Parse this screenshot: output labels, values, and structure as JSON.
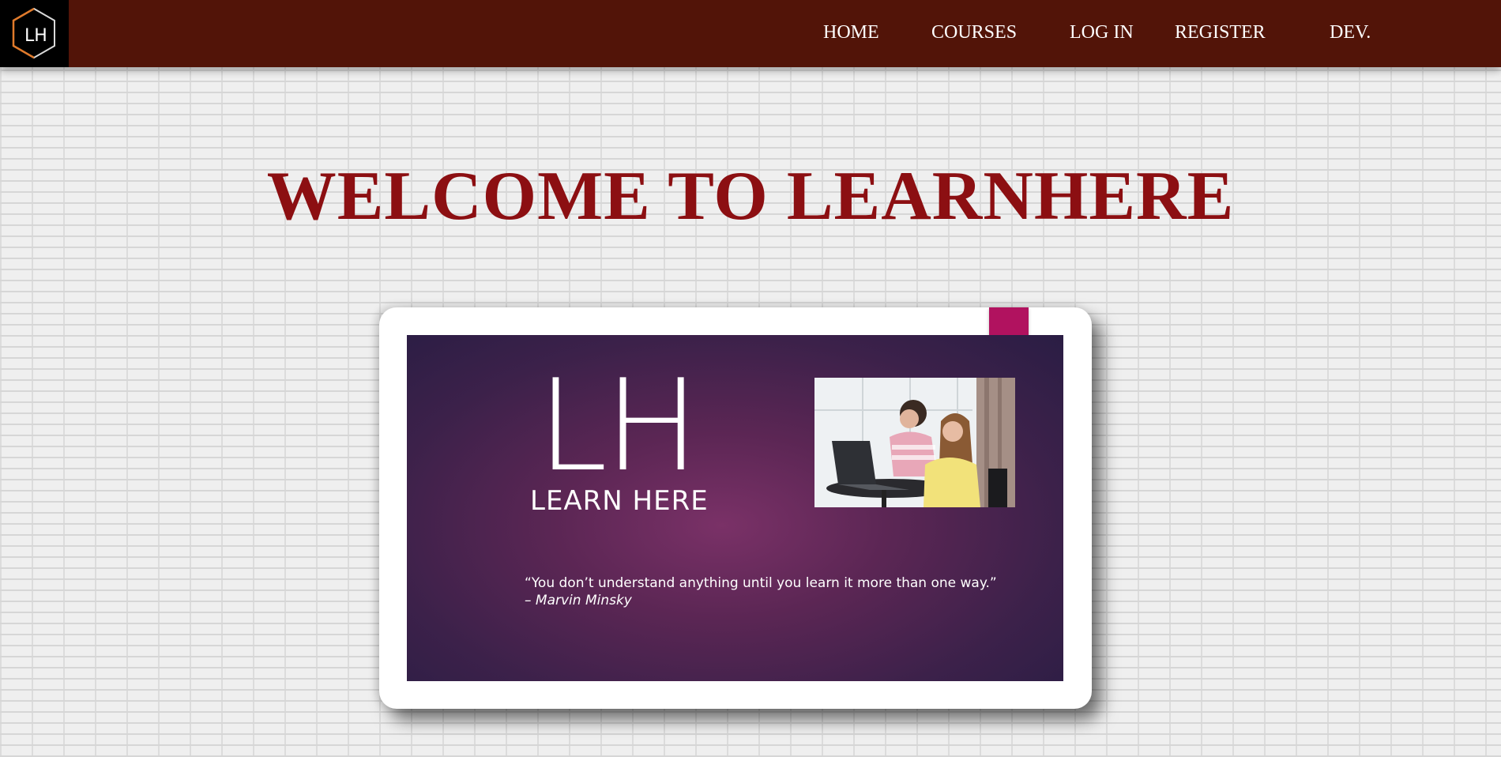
{
  "logo": {
    "text": "LH",
    "icon": "hexagon-logo-icon"
  },
  "nav": {
    "items": [
      {
        "label": "HOME"
      },
      {
        "label": "COURSES"
      },
      {
        "label": "LOG IN"
      },
      {
        "label": "REGISTER"
      },
      {
        "label": "DEV."
      }
    ]
  },
  "main": {
    "title": "WELCOME TO LEARNHERE",
    "banner": {
      "logo_letters": "LH",
      "brand_text": "LEARN HERE",
      "quote": "“You don’t understand anything until you learn it more than one way.”",
      "quote_author": "– Marvin Minsky",
      "photo_subject": "adult and child using a laptop at a table"
    }
  },
  "colors": {
    "header_bg": "#521408",
    "title": "#8c0f12",
    "accent_pink": "#b1125f",
    "banner_purple": "#5b2654"
  }
}
